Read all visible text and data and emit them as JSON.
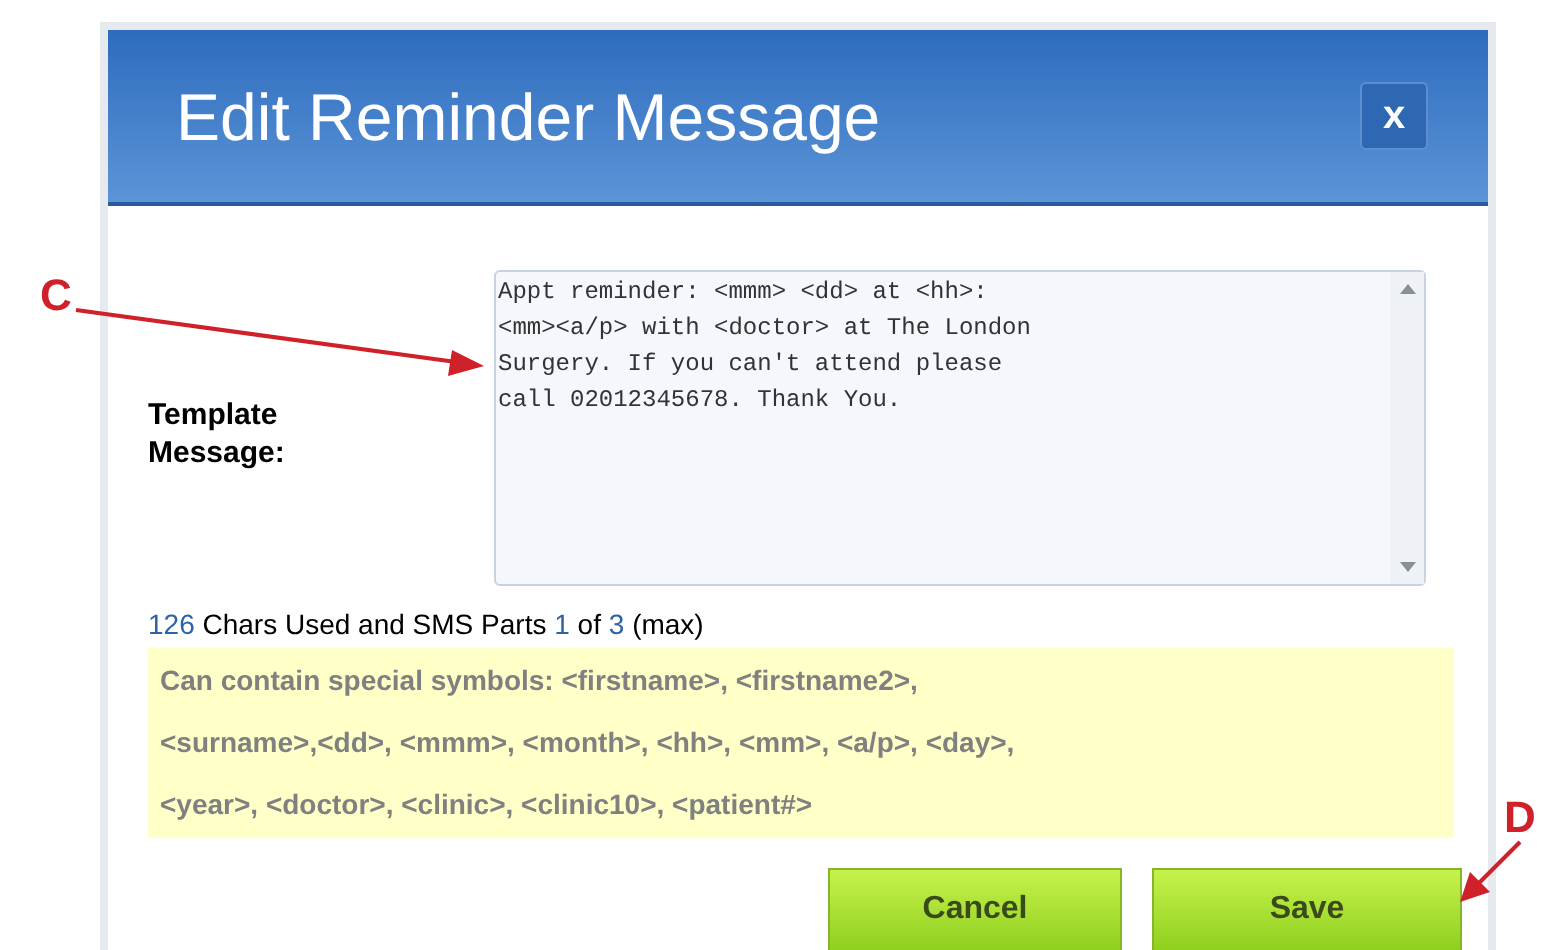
{
  "dialog": {
    "title": "Edit Reminder Message",
    "close_label": "x"
  },
  "template": {
    "label": "Template Message:",
    "value": "Appt reminder: <mmm> <dd> at <hh>:<mm><a/p> with <doctor> at The London Surgery. If you can't attend please call 02012345678. Thank You."
  },
  "char_count": [
    {
      "kind": "number",
      "text": "126"
    },
    {
      "kind": "text",
      "text": "Chars Used and SMS Parts"
    },
    {
      "kind": "number",
      "text": "1"
    },
    {
      "kind": "text",
      "text": "of"
    },
    {
      "kind": "number",
      "text": "3"
    },
    {
      "kind": "text",
      "text": "(max)"
    }
  ],
  "hint": "Can contain special symbols: <firstname>, <firstname2>, <surname>,<dd>, <mmm>, <month>, <hh>, <mm>, <a/p>, <day>, <year>, <doctor>, <clinic>, <clinic10>, <patient#>",
  "buttons": [
    "Cancel",
    "Save"
  ],
  "annotations": [
    {
      "label": "C"
    },
    {
      "label": "D"
    }
  ]
}
